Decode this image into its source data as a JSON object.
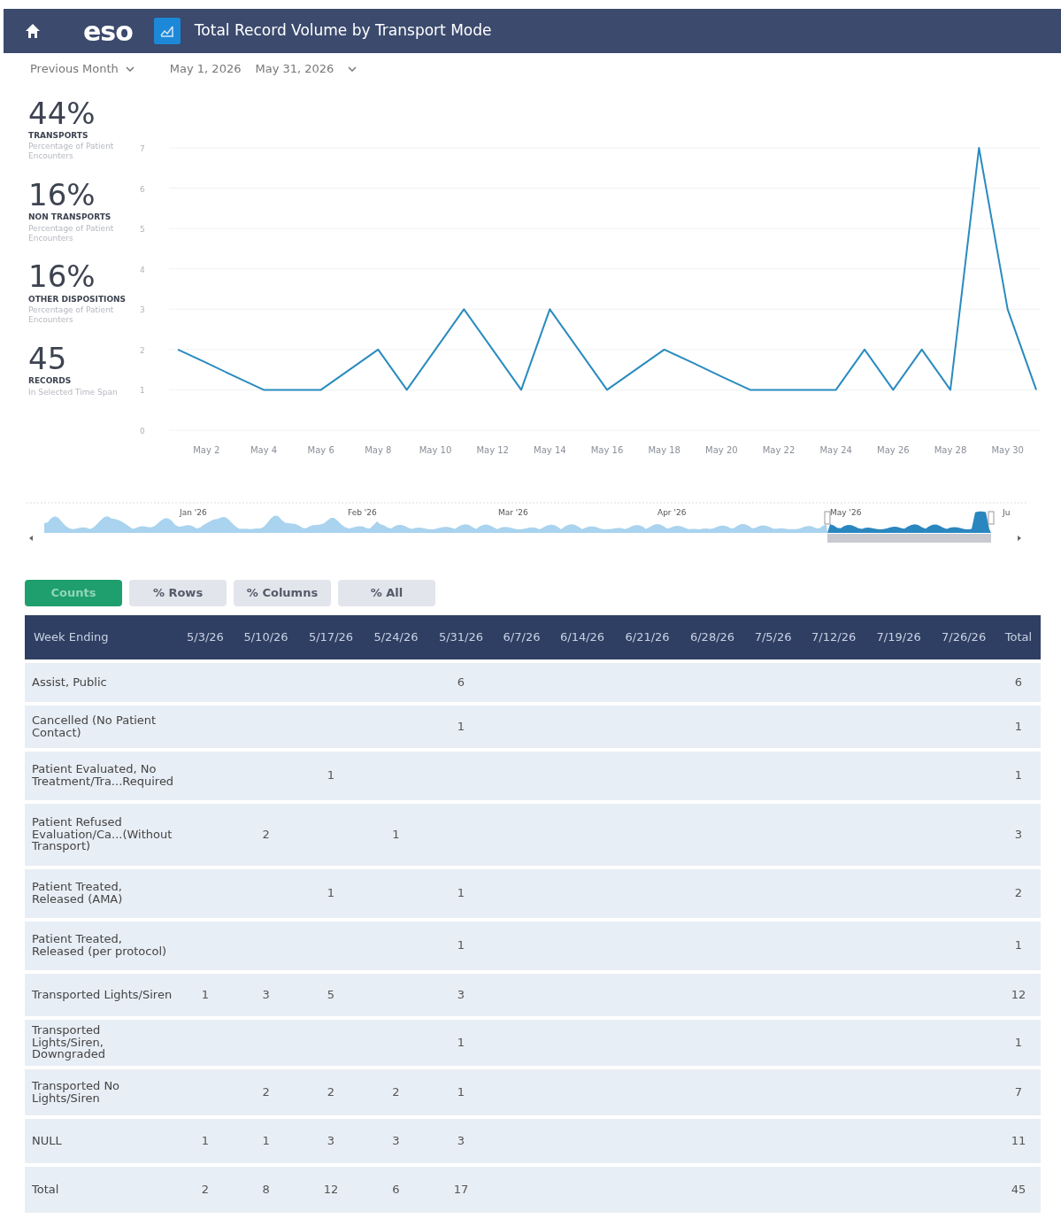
{
  "header": {
    "title": "Total Record Volume by Transport Mode",
    "logo": "eso"
  },
  "filters": {
    "period": "Previous Month",
    "date_start": "May 1, 2026",
    "date_end": "May 31, 2026"
  },
  "kpis": [
    {
      "value": "44%",
      "label": "TRANSPORTS",
      "note": "Percentage of Patient Encounters"
    },
    {
      "value": "16%",
      "label": "NON TRANSPORTS",
      "note": "Percentage of Patient Encounters"
    },
    {
      "value": "16%",
      "label": "OTHER DISPOSITIONS",
      "note": "Percentage of Patient Encounters"
    },
    {
      "value": "45",
      "label": "RECORDS",
      "note": "In Selected Time Span"
    }
  ],
  "chart_data": {
    "type": "line",
    "categories": [
      null,
      "May 2",
      null,
      "May 4",
      null,
      "May 6",
      null,
      "May 8",
      null,
      "May 10",
      null,
      "May 12",
      null,
      "May 14",
      null,
      "May 16",
      null,
      "May 18",
      null,
      "May 20",
      null,
      "May 22",
      null,
      "May 24",
      null,
      "May 26",
      null,
      "May 28",
      null,
      "May 30",
      null
    ],
    "series": [
      {
        "color": "#2a8bbf",
        "values": [
          2,
          1.67,
          1.33,
          1,
          1,
          1,
          1.5,
          2,
          1,
          2,
          3,
          2,
          1,
          3,
          2,
          1,
          1.5,
          2,
          1.67,
          1.33,
          1,
          1,
          1,
          1,
          2,
          1,
          2,
          1,
          7,
          3,
          1
        ]
      }
    ],
    "ylim": [
      0,
      7
    ],
    "grid": true,
    "yticks": [
      0,
      1,
      2,
      3,
      4,
      5,
      6,
      7
    ]
  },
  "navigator": {
    "labels": [
      "Jan '26",
      "Feb '26",
      "Mar '26",
      "Apr '26",
      "May '26",
      "Ju"
    ]
  },
  "view_buttons": [
    {
      "label": "Counts",
      "selected": true
    },
    {
      "label": "% Rows",
      "selected": false
    },
    {
      "label": "% Columns",
      "selected": false
    },
    {
      "label": "% All",
      "selected": false
    }
  ],
  "table": {
    "columns": [
      "Week Ending",
      "5/3/26",
      "5/10/26",
      "5/17/26",
      "5/24/26",
      "5/31/26",
      "6/7/26",
      "6/14/26",
      "6/21/26",
      "6/28/26",
      "7/5/26",
      "7/12/26",
      "7/19/26",
      "7/26/26",
      "Total"
    ],
    "rows": [
      [
        "Assist, Public",
        "",
        "",
        "",
        "",
        "6",
        "",
        "",
        "",
        "",
        "",
        "",
        "",
        "",
        "6"
      ],
      [
        "Cancelled (No Patient Contact)",
        "",
        "",
        "",
        "",
        "1",
        "",
        "",
        "",
        "",
        "",
        "",
        "",
        "",
        "1"
      ],
      [
        "Patient Evaluated, No Treatment/Tra...Required",
        "",
        "",
        "1",
        "",
        "",
        "",
        "",
        "",
        "",
        "",
        "",
        "",
        "",
        "1"
      ],
      [
        "Patient Refused Evaluation/Ca...(Without Transport)",
        "",
        "2",
        "",
        "1",
        "",
        "",
        "",
        "",
        "",
        "",
        "",
        "",
        "",
        "3"
      ],
      [
        "Patient Treated, Released (AMA)",
        "",
        "",
        "1",
        "",
        "1",
        "",
        "",
        "",
        "",
        "",
        "",
        "",
        "",
        "2"
      ],
      [
        "Patient Treated, Released (per protocol)",
        "",
        "",
        "",
        "",
        "1",
        "",
        "",
        "",
        "",
        "",
        "",
        "",
        "",
        "1"
      ],
      [
        "Transported Lights/Siren",
        "1",
        "3",
        "5",
        "",
        "3",
        "",
        "",
        "",
        "",
        "",
        "",
        "",
        "",
        "12"
      ],
      [
        "Transported Lights/Siren, Downgraded",
        "",
        "",
        "",
        "",
        "1",
        "",
        "",
        "",
        "",
        "",
        "",
        "",
        "",
        "1"
      ],
      [
        "Transported No Lights/Siren",
        "",
        "2",
        "2",
        "2",
        "1",
        "",
        "",
        "",
        "",
        "",
        "",
        "",
        "",
        "7"
      ],
      [
        "NULL",
        "1",
        "1",
        "3",
        "3",
        "3",
        "",
        "",
        "",
        "",
        "",
        "",
        "",
        "",
        "11"
      ],
      [
        "Total",
        "2",
        "8",
        "12",
        "6",
        "17",
        "",
        "",
        "",
        "",
        "",
        "",
        "",
        "",
        "45"
      ]
    ]
  }
}
